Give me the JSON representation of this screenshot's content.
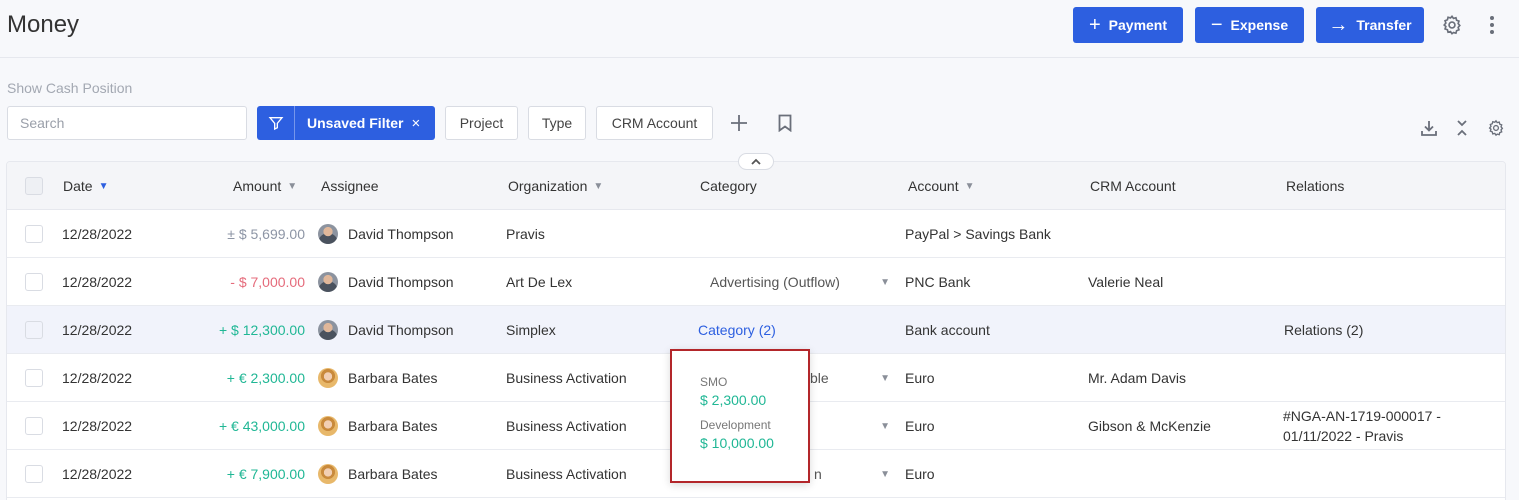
{
  "header": {
    "title": "Money",
    "buttons": {
      "payment": {
        "glyph": "+",
        "label": "Payment"
      },
      "expense": {
        "glyph": "−",
        "label": "Expense"
      },
      "transfer": {
        "glyph": "→",
        "label": "Transfer"
      }
    },
    "icons": [
      "gear-icon",
      "more-vertical-icon"
    ]
  },
  "toolbar": {
    "cash_position_link": "Show Cash Position",
    "search_placeholder": "Search",
    "filter_chip": {
      "label": "Unsaved Filter",
      "close": "×"
    },
    "filter_buttons": [
      "Project",
      "Type",
      "CRM Account"
    ],
    "icons": [
      "plus-icon",
      "bookmark-icon",
      "download-icon",
      "collapse-icon",
      "settings-icon"
    ]
  },
  "table": {
    "columns": [
      "Date",
      "Amount",
      "Assignee",
      "Organization",
      "Category",
      "Account",
      "CRM Account",
      "Relations"
    ],
    "rows": [
      {
        "date": "12/28/2022",
        "amount": "± $ 5,699.00",
        "amount_type": "neutral",
        "assignee": "David Thompson",
        "avatar": "m",
        "organization": "Pravis",
        "category": "",
        "category_type": "none",
        "account": "PayPal > Savings Bank",
        "crm_account": "",
        "relations": ""
      },
      {
        "date": "12/28/2022",
        "amount": "- $ 7,000.00",
        "amount_type": "neg",
        "assignee": "David Thompson",
        "avatar": "m",
        "organization": "Art De Lex",
        "category": "Advertising (Outflow)",
        "category_type": "dropdown",
        "account": "PNC Bank",
        "crm_account": "Valerie Neal",
        "relations": ""
      },
      {
        "date": "12/28/2022",
        "amount": "+ $ 12,300.00",
        "amount_type": "pos",
        "assignee": "David Thompson",
        "avatar": "m",
        "organization": "Simplex",
        "category": "Category (2)",
        "category_type": "link",
        "account": "Bank account",
        "crm_account": "",
        "relations": "Relations (2)"
      },
      {
        "date": "12/28/2022",
        "amount": "+ € 2,300.00",
        "amount_type": "pos",
        "assignee": "Barbara Bates",
        "avatar": "f",
        "organization": "Business Activation",
        "category": "ble",
        "category_type": "dropdown-partial",
        "account": "Euro",
        "crm_account": "Mr. Adam Davis",
        "relations": ""
      },
      {
        "date": "12/28/2022",
        "amount": "+ € 43,000.00",
        "amount_type": "pos",
        "assignee": "Barbara Bates",
        "avatar": "f",
        "organization": "Business Activation",
        "category": "",
        "category_type": "dropdown-partial",
        "account": "Euro",
        "crm_account": "Gibson & McKenzie",
        "relations": "#NGA-AN-1719-000017 - 01/11/2022 - Pravis"
      },
      {
        "date": "12/28/2022",
        "amount": "+ € 7,900.00",
        "amount_type": "pos",
        "assignee": "Barbara Bates",
        "avatar": "f",
        "organization": "Business Activation",
        "category": "n",
        "category_type": "dropdown-partial",
        "account": "Euro",
        "crm_account": "",
        "relations": ""
      }
    ]
  },
  "popover": {
    "items": [
      {
        "label": "SMO",
        "value": "$ 2,300.00"
      },
      {
        "label": "Development",
        "value": "$ 10,000.00"
      }
    ]
  }
}
